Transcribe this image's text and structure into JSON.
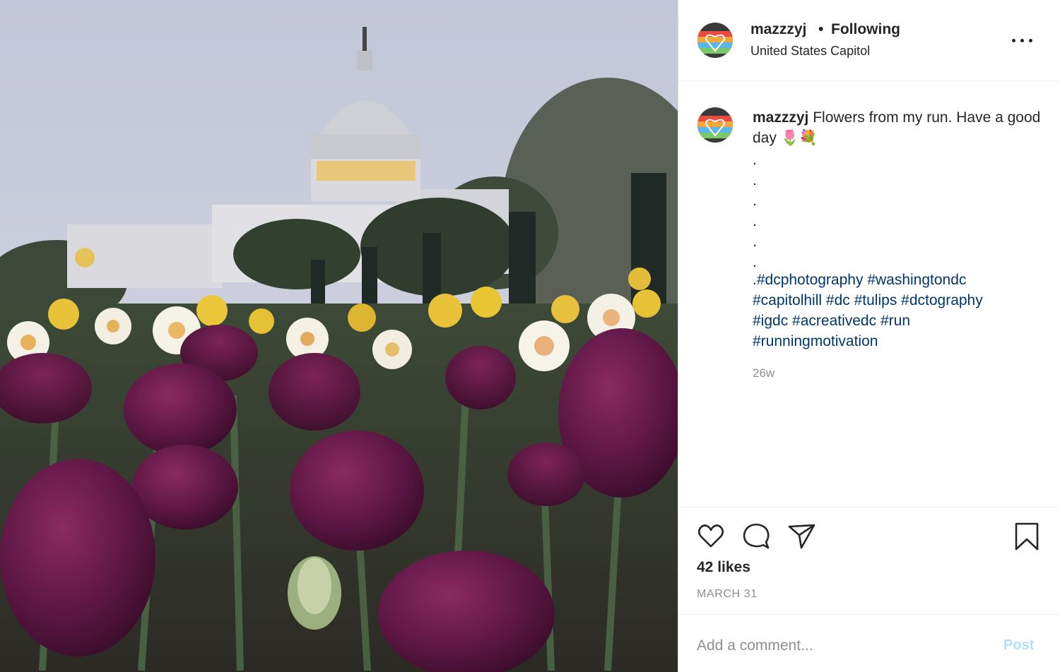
{
  "header": {
    "username": "mazzzyj",
    "separator": "•",
    "follow_status": "Following",
    "location": "United States Capitol",
    "more_icon": "more-dots-icon"
  },
  "caption": {
    "username": "mazzzyj",
    "text": "Flowers from my run. Have a good day 🌷💐",
    "dots": [
      ".",
      ".",
      ".",
      ".",
      ".",
      "."
    ],
    "hashtags": [
      ".#dcphotography",
      "#washingtondc",
      "#capitolhill",
      "#dc",
      "#tulips",
      "#dctography",
      "#igdc",
      "#acreativedc",
      "#run",
      "#runningmotivation"
    ],
    "time_ago": "26w"
  },
  "actions": {
    "icons": [
      "heart-icon",
      "comment-icon",
      "share-icon",
      "bookmark-icon"
    ],
    "likes": "42 likes",
    "date": "MARCH 31"
  },
  "comment_box": {
    "placeholder": "Add a comment...",
    "post_label": "Post"
  },
  "colors": {
    "text": "#262626",
    "hashtag": "#00376b",
    "muted": "#8e8e8e",
    "post_disabled": "#b2dffc",
    "border": "#dbdbdb"
  }
}
